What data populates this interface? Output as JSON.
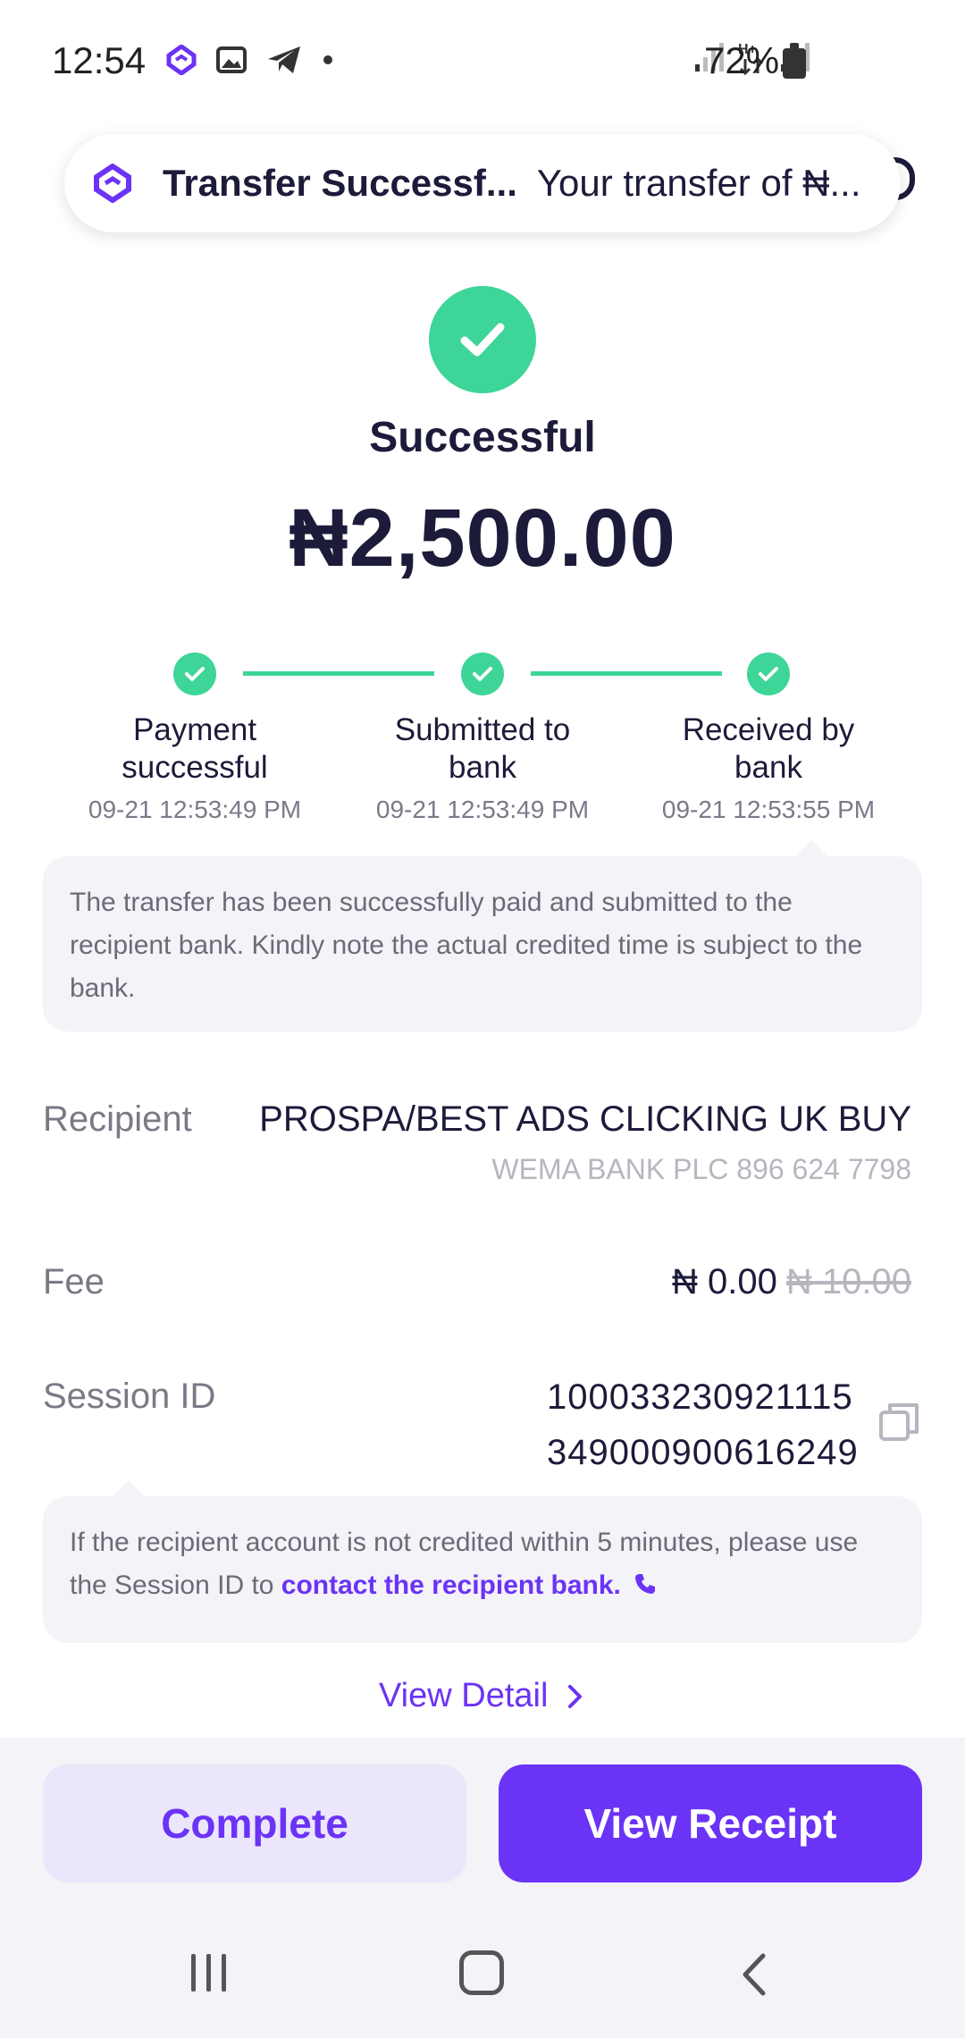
{
  "status_bar": {
    "time": "12:54",
    "battery": "72%"
  },
  "notification": {
    "title": "Transfer Successf...",
    "body": "Your transfer of ₦..."
  },
  "header": {
    "status": "Successful",
    "amount": "₦2,500.00"
  },
  "steps": [
    {
      "label": "Payment successful",
      "time": "09-21 12:53:49 PM"
    },
    {
      "label": "Submitted to bank",
      "time": "09-21 12:53:49 PM"
    },
    {
      "label": "Received by bank",
      "time": "09-21 12:53:55 PM"
    }
  ],
  "step_note": "The transfer has been successfully paid and submitted to the recipient bank. Kindly note the actual credited time is subject to the bank.",
  "details": {
    "recipient_label": "Recipient",
    "recipient_name": "PROSPA/BEST ADS CLICKING UK BUY",
    "recipient_bank": "WEMA BANK PLC 896 624 7798",
    "fee_label": "Fee",
    "fee_value": "₦ 0.00",
    "fee_original": "₦ 10.00",
    "session_label": "Session ID",
    "session_line1": "100033230921115",
    "session_line2": "349000900616249"
  },
  "session_note": {
    "text": "If the recipient account is not credited within 5 minutes, please use the Session ID to ",
    "link": "contact the recipient bank."
  },
  "view_detail": "View Detail",
  "buttons": {
    "complete": "Complete",
    "receipt": "View Receipt"
  },
  "colors": {
    "accent": "#6b33f5",
    "success": "#3dd598",
    "text": "#1c1b3a"
  }
}
